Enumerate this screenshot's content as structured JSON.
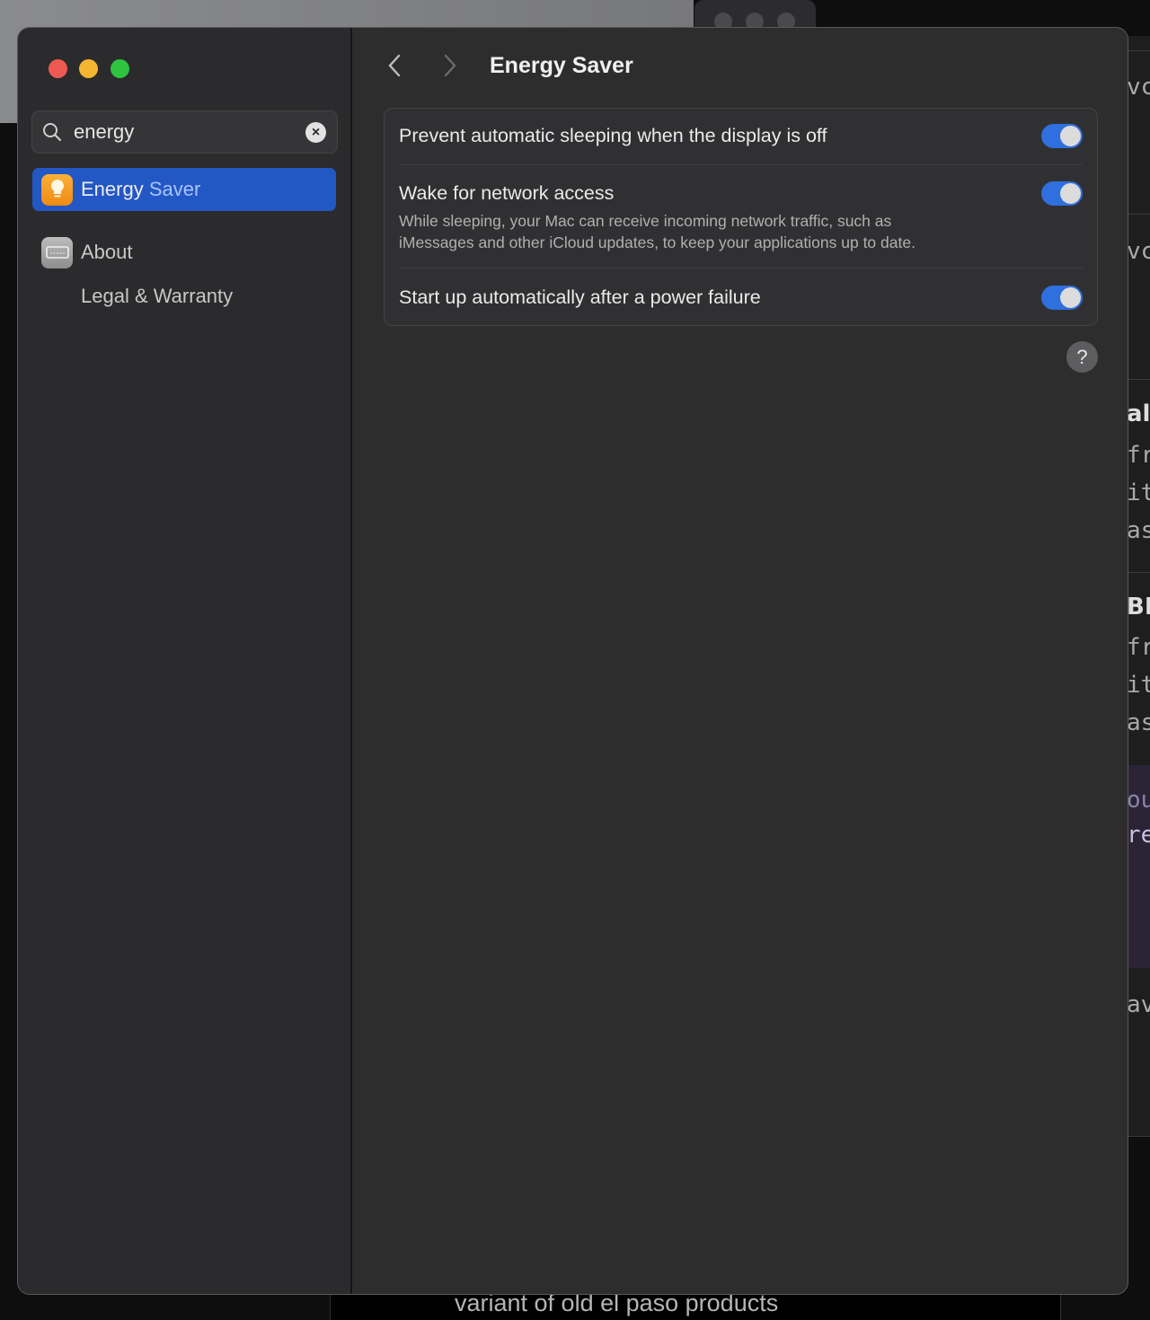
{
  "window": {
    "title": "Energy Saver",
    "traffic_colors": {
      "close": "#ee5a52",
      "minimize": "#f4b631",
      "zoom": "#2ec440"
    }
  },
  "sidebar": {
    "search": {
      "value": "energy"
    },
    "items": [
      {
        "label_match": "Energy",
        "label_rest": " Saver",
        "selected": true
      },
      {
        "label": "About"
      },
      {
        "label": "Legal & Warranty"
      }
    ]
  },
  "main": {
    "settings": [
      {
        "label": "Prevent automatic sleeping when the display is off",
        "enabled": true
      },
      {
        "label": "Wake for network access",
        "description_line1": "While sleeping, your Mac can receive incoming network traffic, such as",
        "description_line2": "iMessages and other iCloud updates, to keep your applications up to date.",
        "enabled": true
      },
      {
        "label": "Start up automatically after a power failure",
        "enabled": true
      }
    ],
    "help": "?"
  },
  "background": {
    "fragments": [
      "vc",
      "vc",
      "al",
      "fri",
      "ite",
      "as",
      "BL",
      "fri",
      "ite",
      "as",
      "ou",
      "re",
      "av"
    ],
    "bottom_text": "variant of old el paso products"
  },
  "accent": "#2f6fde"
}
